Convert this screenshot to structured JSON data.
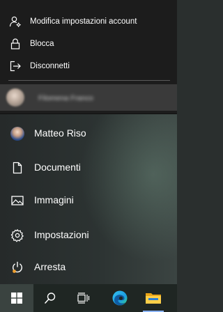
{
  "account_menu": {
    "items": [
      {
        "label": "Modifica impostazioni account",
        "icon": "account-settings-icon"
      },
      {
        "label": "Blocca",
        "icon": "lock-icon"
      },
      {
        "label": "Disconnetti",
        "icon": "sign-out-icon"
      }
    ],
    "other_user": {
      "name": "Filomena Franco",
      "icon": "avatar"
    }
  },
  "start_menu": {
    "items": [
      {
        "label": "Matteo Riso",
        "icon": "user-avatar"
      },
      {
        "label": "Documenti",
        "icon": "document-icon"
      },
      {
        "label": "Immagini",
        "icon": "pictures-icon"
      },
      {
        "label": "Impostazioni",
        "icon": "gear-icon"
      },
      {
        "label": "Arresta",
        "icon": "power-icon"
      }
    ]
  },
  "taskbar": {
    "buttons": [
      {
        "name": "start",
        "icon": "windows-logo-icon"
      },
      {
        "name": "search",
        "icon": "search-icon"
      },
      {
        "name": "task-view",
        "icon": "task-view-icon"
      },
      {
        "name": "edge",
        "icon": "edge-icon"
      },
      {
        "name": "file-explorer",
        "icon": "folder-icon"
      }
    ],
    "accent": "#8ab4ff"
  }
}
